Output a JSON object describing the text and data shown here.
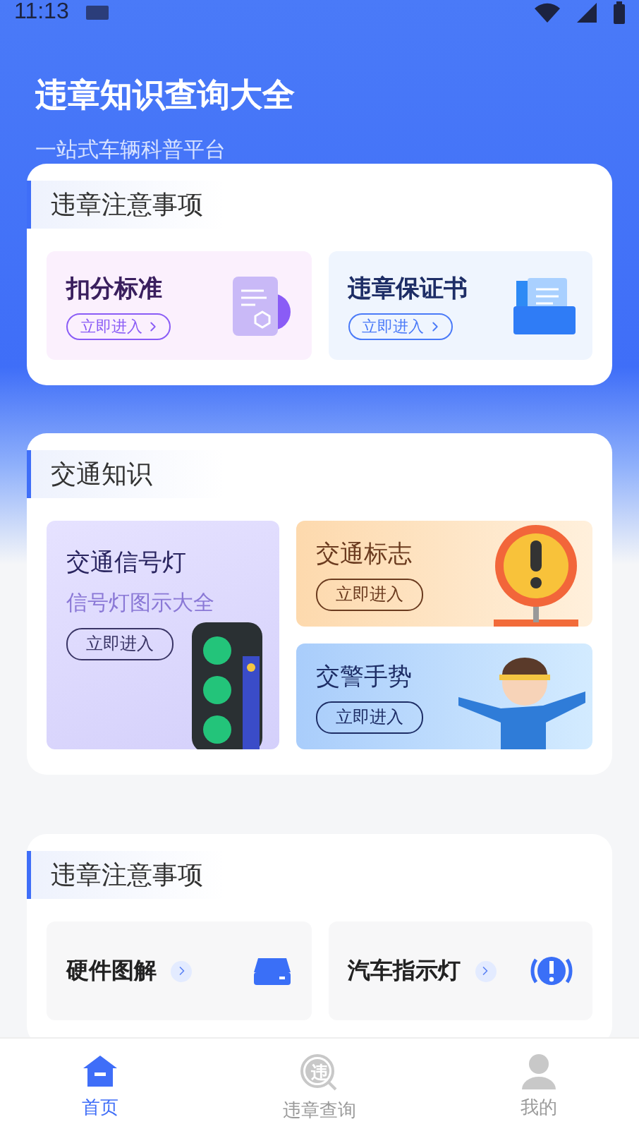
{
  "status_bar": {
    "time": "11:13"
  },
  "header": {
    "title": "违章知识查询大全",
    "subtitle": "一站式车辆科普平台"
  },
  "notice_section": {
    "title": "违章注意事项",
    "items": [
      {
        "kind": "points",
        "title": "扣分标准",
        "button": "立即进入"
      },
      {
        "kind": "pledge",
        "title": "违章保证书",
        "button": "立即进入"
      }
    ]
  },
  "knowledge_section": {
    "title": "交通知识",
    "items": [
      {
        "kind": "signal",
        "title": "交通信号灯",
        "subtitle": "信号灯图示大全",
        "button": "立即进入"
      },
      {
        "kind": "sign",
        "title": "交通标志",
        "button": "立即进入"
      },
      {
        "kind": "gesture",
        "title": "交警手势",
        "button": "立即进入"
      }
    ]
  },
  "guide_section": {
    "title": "违章注意事项",
    "items": [
      {
        "kind": "hardware",
        "title": "硬件图解"
      },
      {
        "kind": "indicator",
        "title": "汽车指示灯"
      }
    ]
  },
  "bottom_nav": [
    {
      "kind": "home",
      "label": "首页",
      "selected": true
    },
    {
      "kind": "query",
      "label": "违章查询",
      "icon_glyph": "违",
      "selected": false
    },
    {
      "kind": "profile",
      "label": "我的",
      "selected": false
    }
  ]
}
